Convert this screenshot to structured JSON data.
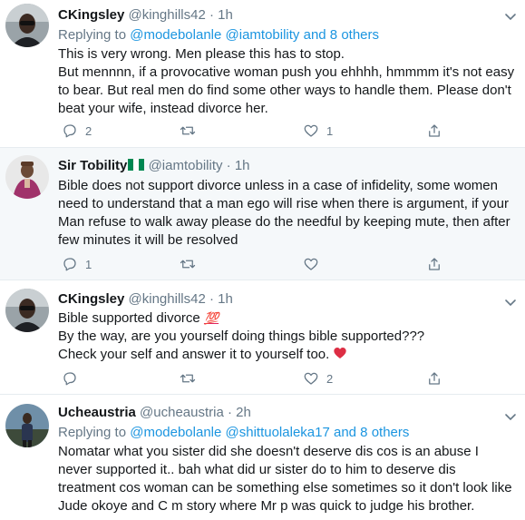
{
  "tweets": [
    {
      "name": "CKingsley",
      "handle": "@kinghills42",
      "dot": "·",
      "time": "1h",
      "replying_prefix": "Replying to",
      "replying_mentions": "@modebolanle @iamtobility",
      "replying_suffix": "and 8 others",
      "lines": [
        "This is very wrong. Men please this has to stop.",
        "But mennnn, if a provocative woman push you ehhhh, hmmmm it's not easy to bear. But real men do find some other ways to handle them. Please don't beat your wife, instead divorce her."
      ],
      "reply_count": "2",
      "retweet_count": "",
      "like_count": "1"
    },
    {
      "name": "Sir Tobility",
      "handle": "@iamtobility",
      "dot": "·",
      "time": "1h",
      "text": "Bible does not support divorce unless in a case of infidelity, some women need to understand that a man ego will rise when there is argument, if your Man refuse to walk away please do the needful by keeping mute, then after few minutes it will be resolved",
      "reply_count": "1",
      "retweet_count": "",
      "like_count": ""
    },
    {
      "name": "CKingsley",
      "handle": "@kinghills42",
      "dot": "·",
      "time": "1h",
      "line1": "Bible supported divorce",
      "emoji1": "💯",
      "line2": "By the way, are you yourself doing things bible supported???",
      "line3": "Check your self and answer it to yourself too.",
      "reply_count": "",
      "retweet_count": "",
      "like_count": "2"
    },
    {
      "name": "Ucheaustria",
      "handle": "@ucheaustria",
      "dot": "·",
      "time": "2h",
      "replying_prefix": "Replying to",
      "replying_mentions": "@modebolanle @shittuolaleka17",
      "replying_suffix": "and 8 others",
      "text": "Nomatar what you sister did she doesn't deserve dis cos is an abuse I never supported it.. bah what did ur sister do to him to deserve dis treatment cos woman can be something else sometimes so it don't look like Jude okoye and C m story where Mr p was quick to judge his brother."
    }
  ],
  "colors": {
    "accent": "#1b95e0",
    "secondary_text": "#657786",
    "highlight_bg": "#f5f8fa",
    "heart": "#e0245e"
  },
  "icons": [
    "reply-icon",
    "retweet-icon",
    "like-icon",
    "share-icon",
    "chevron-down-icon",
    "nigeria-flag-icon",
    "hundred-points-emoji",
    "red-heart-emoji"
  ]
}
